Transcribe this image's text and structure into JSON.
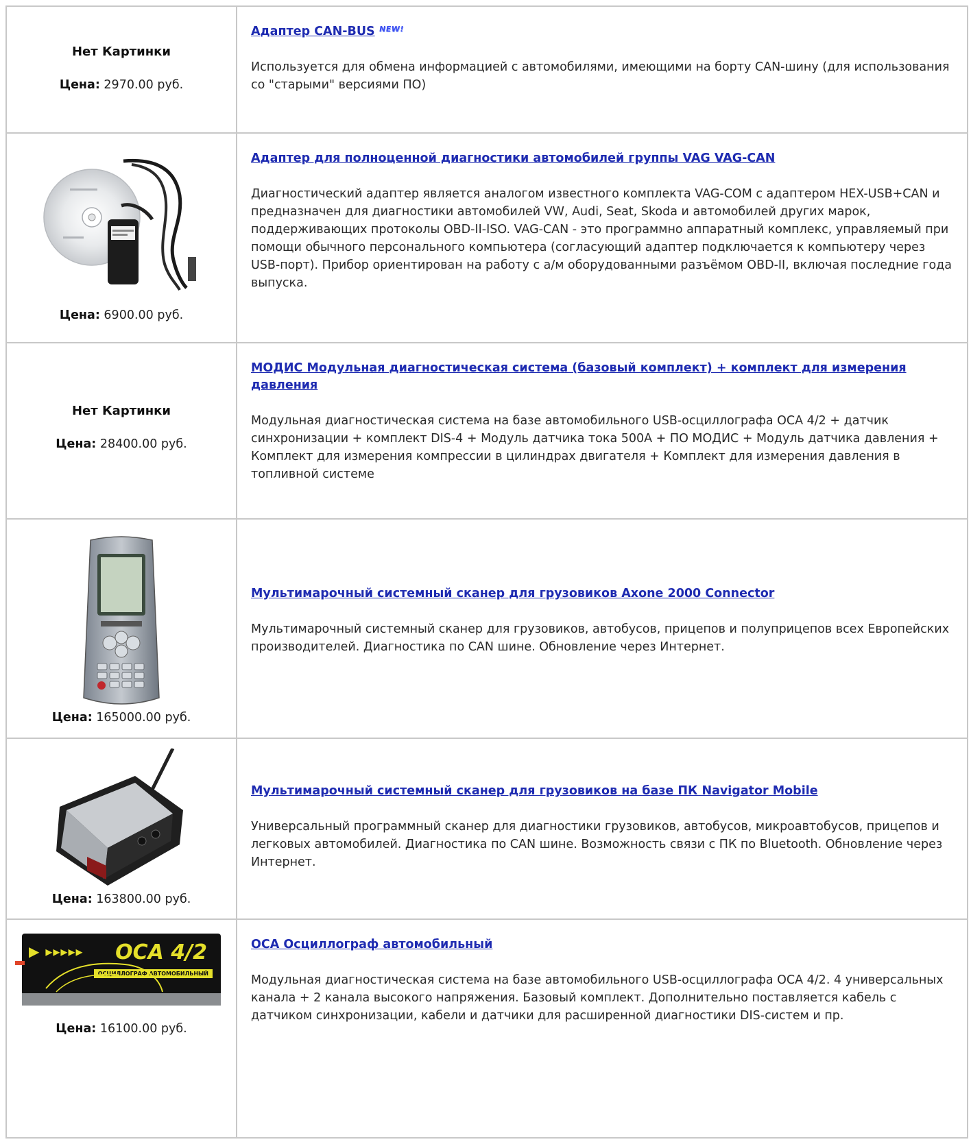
{
  "price_label": "Цена",
  "no_picture_text": "Нет Картинки",
  "new_badge_text": "NEW!",
  "products": [
    {
      "title": "Адаптер CAN-BUS",
      "description": "Используется для обмена информацией с автомобилями, имеющими на борту CAN-шину (для использования со \"старыми\" версиями ПО)",
      "price": "2970.00 руб.",
      "has_image": false,
      "is_new": true
    },
    {
      "title": "Адаптер для полноценной диагностики автомобилей группы VAG VAG-CAN",
      "description": "Диагностический адаптер является аналогом известного комплекта VAG-COM с адаптером HEX-USB+CAN и предназначен для диагностики автомобилей VW, Audi, Seat, Skoda и автомобилей других марок, поддерживающих протоколы OBD-II-ISO. VAG-CAN - это программно аппаратный комплекс, управляемый при помощи обычного персонального компьютера (согласующий адаптер подключается к компьютеру через USB-порт). Прибор ориентирован на работу с а/м оборудованными разъёмом OBD-II, включая последние года выпуска.",
      "price": "6900.00 руб.",
      "has_image": true,
      "image_icon": "cd-cable-adapter-icon"
    },
    {
      "title": "МОДИС Модульная диагностическая система (базовый комплект) + комплект для измерения давления",
      "description": "Модульная диагностическая система на базе автомобильного USB-осциллографа ОСА 4/2 + датчик синхронизации + комплект DIS-4 + Модуль датчика тока 500А + ПО МОДИС + Модуль датчика давления + Комплект для измерения компрессии в цилиндрах двигателя + Комплект для измерения давления в топливной системе",
      "price": "28400.00 руб.",
      "has_image": false
    },
    {
      "title": "Мультимарочный системный сканер для грузовиков Axone 2000 Connector",
      "description": "Мультимарочный системный сканер для грузовиков, автобусов, прицепов и полуприцепов всех Европейских производителей. Диагностика по CAN шине. Обновление через Интернет.",
      "price": "165000.00 руб.",
      "has_image": true,
      "image_icon": "handheld-scanner-icon"
    },
    {
      "title": "Мультимарочный системный сканер для грузовиков на базе ПК Navigator Mobile",
      "description": "Универсальный программный сканер для диагностики грузовиков, автобусов, микроавтобусов, прицепов и легковых автомобилей. Диагностика по CAN шине. Возможность связи с ПК по Bluetooth. Обновление через Интернет.",
      "price": "163800.00 руб.",
      "has_image": true,
      "image_icon": "vci-box-icon"
    },
    {
      "title": "ОСА Осциллограф автомобильный",
      "description": "Модульная диагностическая система на базе автомобильного USB-осциллографа ОСА 4/2. 4 универсальных канала + 2 канала высокого напряжения. Базовый комплект. Дополнительно поставляется кабель с датчиком синхронизации, кабели и датчики для расширенной диагностики DIS-систем и пр.",
      "price": "16100.00 руб.",
      "has_image": true,
      "image_icon": "oscilloscope-icon",
      "image_label": "ОСА 4/2",
      "image_sublabel": "ОСЦИЛЛОГРАФ АВТОМОБИЛЬНЫЙ"
    }
  ]
}
